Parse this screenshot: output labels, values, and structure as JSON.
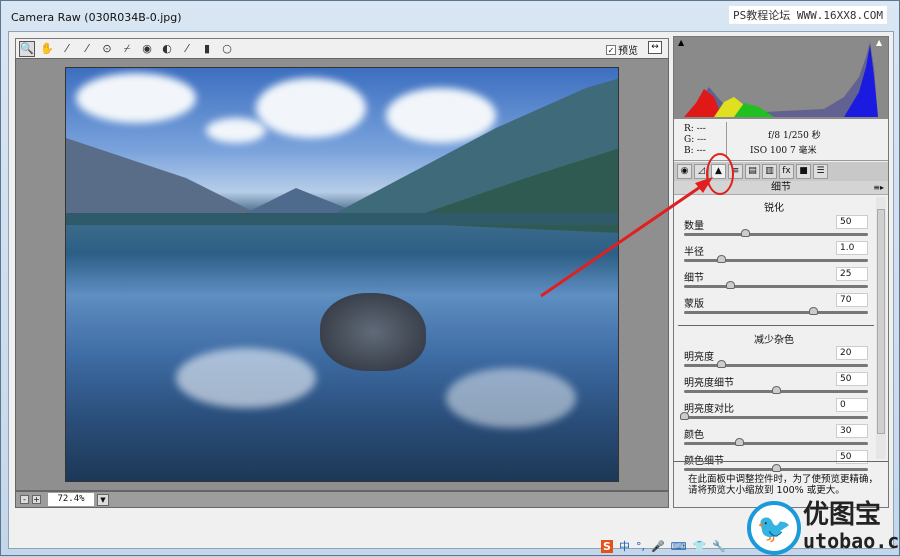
{
  "window": {
    "title": "Camera Raw (030R034B-0.jpg)",
    "watermark": "PS教程论坛 WWW.16XX8.COM"
  },
  "toolbar": {
    "tools": [
      "zoom-icon",
      "hand-icon",
      "white-balance-icon",
      "color-sampler-icon",
      "targeted-adjust-icon",
      "crop-icon",
      "straighten-icon",
      "red-eye-icon",
      "brush-icon",
      "gradient-icon",
      "radial-icon"
    ],
    "preview_label": "预览",
    "preview_checked": true
  },
  "zoom": {
    "minus": "-",
    "plus": "+",
    "value": "72.4%"
  },
  "info": {
    "r": "R:  ---",
    "g": "G:  ---",
    "b": "B:  ---",
    "exposure": "f/8   1/250 秒",
    "iso": "ISO 100   7 毫米"
  },
  "panel": {
    "header": "细节",
    "sharpen": {
      "title": "锐化",
      "sliders": [
        {
          "label": "数量",
          "value": "50",
          "fraction": 0.33
        },
        {
          "label": "半径",
          "value": "1.0",
          "fraction": 0.2
        },
        {
          "label": "细节",
          "value": "25",
          "fraction": 0.25
        },
        {
          "label": "蒙版",
          "value": "70",
          "fraction": 0.7
        }
      ]
    },
    "noise": {
      "title": "减少杂色",
      "sliders": [
        {
          "label": "明亮度",
          "value": "20",
          "fraction": 0.2
        },
        {
          "label": "明亮度细节",
          "value": "50",
          "fraction": 0.5
        },
        {
          "label": "明亮度对比",
          "value": "0",
          "fraction": 0
        },
        {
          "label": "颜色",
          "value": "30",
          "fraction": 0.3
        },
        {
          "label": "颜色细节",
          "value": "50",
          "fraction": 0.5
        }
      ]
    },
    "hint": "在此面板中调整控件时，为了使预览更精确，请将预览大小缩放到 100% 或更大。"
  },
  "logo": {
    "line1": "优图宝",
    "line2": "utobao.com"
  },
  "tray": {
    "ime": "S",
    "lang": "中"
  },
  "colors": {
    "accent": "#1a9ad9",
    "annotation": "#e02020"
  }
}
